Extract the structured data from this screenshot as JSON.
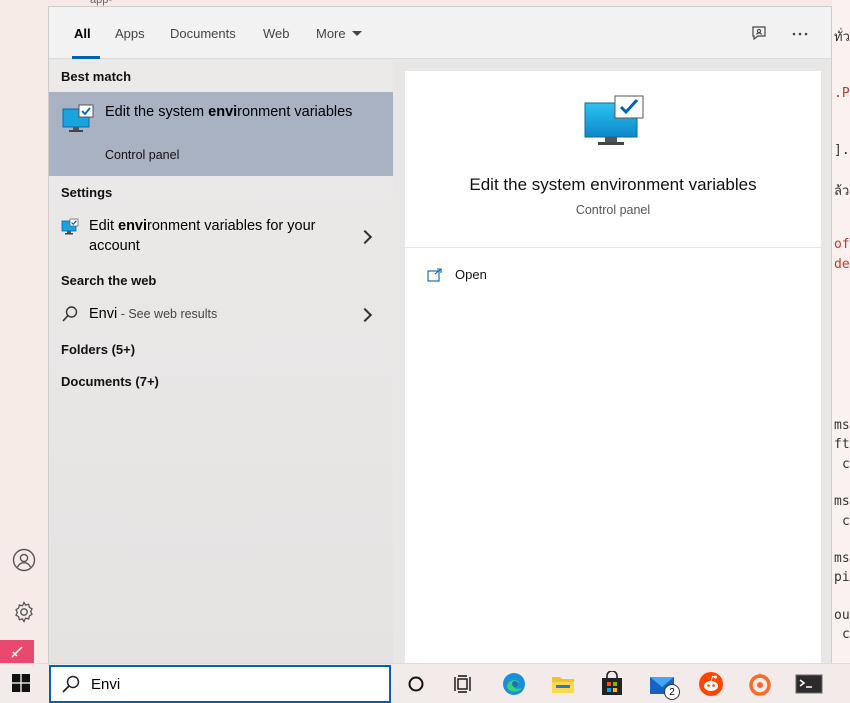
{
  "background": {
    "top_fragment": "app-dev",
    "right_fragments": [
      "ทั่ว",
      ".Pa",
      "].c",
      "ล้ว",
      "oft",
      "de.",
      "ms",
      "ft",
      "c",
      "ms",
      "c",
      "ms",
      "pi",
      "out",
      "c"
    ]
  },
  "tabs": {
    "items": [
      {
        "label": "All",
        "active": true
      },
      {
        "label": "Apps"
      },
      {
        "label": "Documents"
      },
      {
        "label": "Web"
      },
      {
        "label": "More"
      }
    ],
    "feedback_icon": "feedback-icon",
    "more_options_icon": "ellipsis-icon"
  },
  "results": {
    "best_match_header": "Best match",
    "best_match": {
      "title_pre": "Edit the system ",
      "title_bold": "envi",
      "title_post": "ronment variables",
      "subtitle": "Control panel",
      "icon": "system-monitor-icon"
    },
    "settings_header": "Settings",
    "settings_item": {
      "title_pre": "Edit ",
      "title_bold": "envi",
      "title_post": "ronment variables for your account",
      "icon": "settings-monitor-icon"
    },
    "web_header": "Search the web",
    "web_item": {
      "query": "Envi",
      "suffix": " - See web results",
      "icon": "search-icon"
    },
    "folders_label": "Folders (5+)",
    "documents_label": "Documents (7+)"
  },
  "preview": {
    "title": "Edit the system environment variables",
    "subtitle": "Control panel",
    "open_label": "Open",
    "icon": "system-monitor-icon"
  },
  "taskbar": {
    "search_value": "Envi",
    "mail_badge": "2",
    "icons": [
      "windows-start-icon",
      "cortana-icon",
      "task-view-icon",
      "edge-icon",
      "file-explorer-icon",
      "store-icon",
      "mail-icon",
      "reddit-icon",
      "origin-icon",
      "terminal-icon"
    ]
  },
  "colors": {
    "accent": "#0063b1",
    "selected_row": "#a9b2c3",
    "pink_tile": "#e84a6f"
  }
}
